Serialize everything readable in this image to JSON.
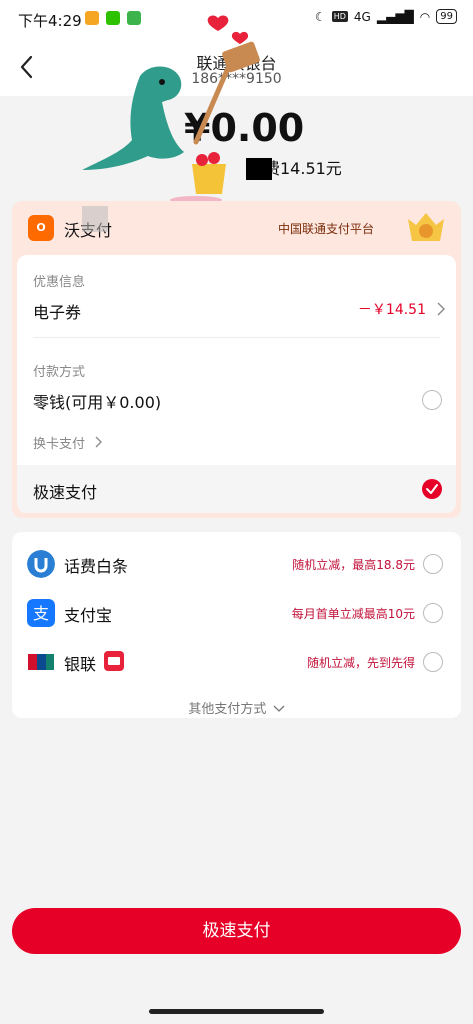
{
  "status_bar": {
    "time": "下午4:29",
    "network": "4G",
    "battery": "99"
  },
  "header": {
    "title": "联通沃银台",
    "subtitle": "186****9150"
  },
  "summary": {
    "amount": "¥0.00",
    "fee_label": "交费14.51元"
  },
  "wo_pay": {
    "name": "沃支付",
    "logo_text": "O",
    "platform": "中国联通支付平台",
    "discount_section_label": "优惠信息",
    "coupon_label": "电子券",
    "coupon_value": "－￥14.51",
    "payment_method_label": "付款方式",
    "balance_label": "零钱(可用￥0.00)",
    "switch_card_label": "换卡支付",
    "fast_pay_label": "极速支付"
  },
  "pay_options": [
    {
      "name": "话费白条",
      "promo": "随机立减，最高18.8元",
      "icon": "baitiao-icon"
    },
    {
      "name": "支付宝",
      "promo": "每月首单立减最高10元",
      "icon": "alipay-icon"
    },
    {
      "name": "银联",
      "promo": "随机立减，先到先得",
      "icon": "unionpay-icon"
    }
  ],
  "more_methods": "其他支付方式",
  "primary_button": "极速支付",
  "colors": {
    "accent": "#e60027",
    "wo_card_bg": "#fde7df",
    "wo_logo": "#ff6a00"
  }
}
